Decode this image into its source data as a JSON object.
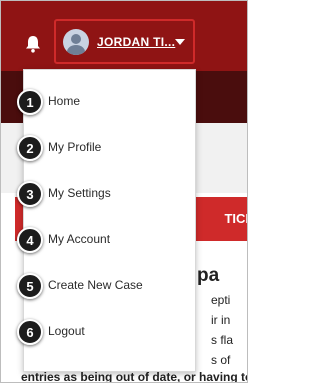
{
  "header": {
    "user_name": "JORDAN TI...",
    "colors": {
      "header_bg": "#8f1414",
      "accent": "#cf2a2a"
    }
  },
  "background": {
    "cta_fragment": "TICI",
    "text_fragments": [
      "pa",
      "epti",
      "ir in",
      "s fla",
      "s of"
    ],
    "bottom_line": "entries as being out of date, or having to"
  },
  "menu": {
    "items": [
      {
        "label": "Home",
        "marker": "1"
      },
      {
        "label": "My Profile",
        "marker": "2"
      },
      {
        "label": "My Settings",
        "marker": "3"
      },
      {
        "label": "My Account",
        "marker": "4"
      },
      {
        "label": "Create New Case",
        "marker": "5"
      },
      {
        "label": "Logout",
        "marker": "6"
      }
    ]
  },
  "icons": {
    "notifications": "bell-icon",
    "avatar": "user-avatar-icon",
    "dropdown": "chevron-down-icon"
  }
}
